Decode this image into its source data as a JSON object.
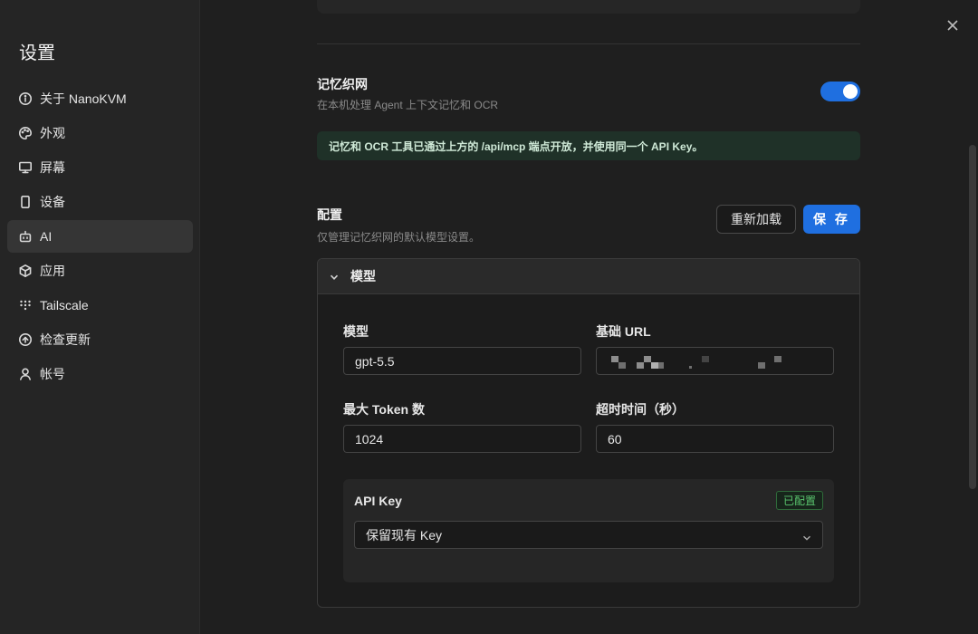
{
  "sidebar": {
    "title": "设置",
    "items": [
      {
        "label": "关于 NanoKVM",
        "icon": "info-icon"
      },
      {
        "label": "外观",
        "icon": "palette-icon"
      },
      {
        "label": "屏幕",
        "icon": "monitor-icon"
      },
      {
        "label": "设备",
        "icon": "device-icon"
      },
      {
        "label": "AI",
        "icon": "bot-icon",
        "active": true
      },
      {
        "label": "应用",
        "icon": "package-icon"
      },
      {
        "label": "Tailscale",
        "icon": "tailscale-icon"
      },
      {
        "label": "检查更新",
        "icon": "update-icon"
      },
      {
        "label": "帐号",
        "icon": "user-icon"
      }
    ]
  },
  "memory": {
    "title": "记忆织网",
    "description": "在本机处理 Agent 上下文记忆和 OCR",
    "enabled": true,
    "banner": "记忆和 OCR 工具已通过上方的 /api/mcp 端点开放，并使用同一个 API Key。"
  },
  "config": {
    "title": "配置",
    "description": "仅管理记忆织网的默认模型设置。",
    "reload_label": "重新加载",
    "save_label": "保 存"
  },
  "model_panel": {
    "header": "模型",
    "model_label": "模型",
    "model_value": "gpt-5.5",
    "base_url_label": "基础 URL",
    "max_tokens_label": "最大 Token 数",
    "max_tokens_value": "1024",
    "timeout_label": "超时时间（秒）",
    "timeout_value": "60",
    "api_key": {
      "label": "API Key",
      "status": "已配置",
      "selected": "保留现有 Key"
    }
  },
  "colors": {
    "accent": "#1f6fe0",
    "success": "#5ac46e"
  }
}
